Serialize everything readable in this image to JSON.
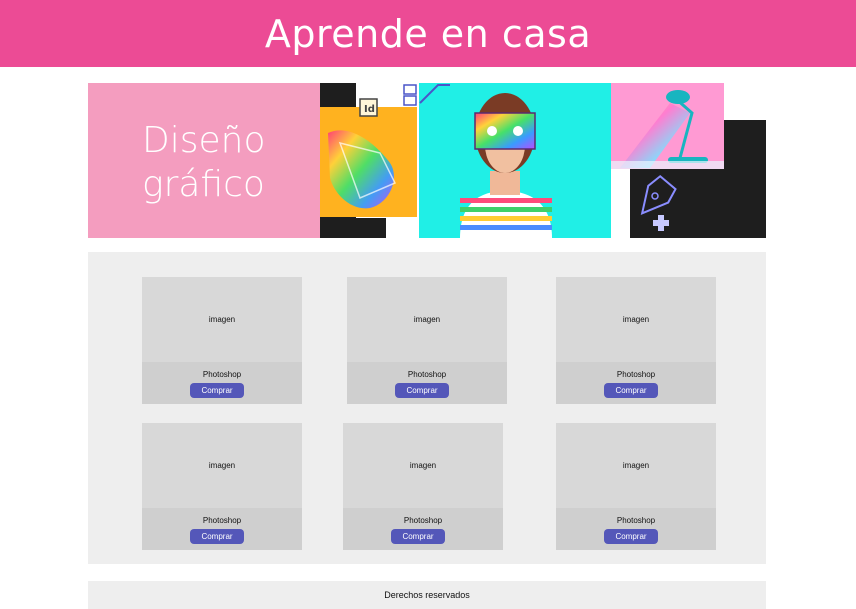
{
  "header": {
    "title": "Aprende en casa"
  },
  "banner": {
    "title_line1": "Diseño",
    "title_line2": "gráfico",
    "indesign_badge": "Id"
  },
  "products": [
    {
      "image_label": "imagen",
      "name": "Photoshop",
      "button_label": "Comprar"
    },
    {
      "image_label": "imagen",
      "name": "Photoshop",
      "button_label": "Comprar"
    },
    {
      "image_label": "imagen",
      "name": "Photoshop",
      "button_label": "Comprar"
    },
    {
      "image_label": "imagen",
      "name": "Photoshop",
      "button_label": "Comprar"
    },
    {
      "image_label": "imagen",
      "name": "Photoshop",
      "button_label": "Comprar"
    },
    {
      "image_label": "imagen",
      "name": "Photoshop",
      "button_label": "Comprar"
    }
  ],
  "footer": {
    "text": "Derechos reservados"
  },
  "colors": {
    "header": "#ec4b95",
    "banner_panel": "#f49dbf",
    "button": "#5457b9",
    "section_bg": "#eeeeee"
  }
}
